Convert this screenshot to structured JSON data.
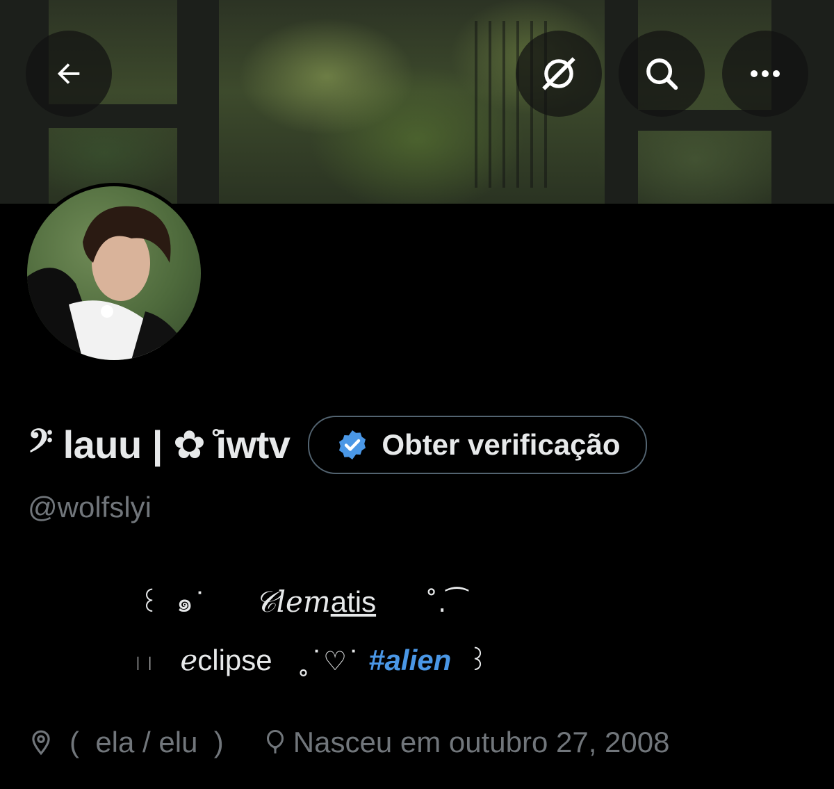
{
  "header": {
    "buttons": [
      {
        "name": "back-button",
        "icon": "arrow-left-icon"
      },
      {
        "name": "grok-button",
        "icon": "grok-icon"
      },
      {
        "name": "search-button",
        "icon": "search-icon"
      },
      {
        "name": "more-button",
        "icon": "more-horizontal-icon"
      }
    ]
  },
  "profile": {
    "display_name": "𝄢 lauu | ✿ ̊iwtv",
    "handle": "@wolfslyi",
    "verify_label": "Obter verificação",
    "verified_color": "#4a97e6"
  },
  "bio": {
    "line1_prefix": "꒰  ๑˙",
    "line1_word_start": "𝒞lem",
    "line1_word_end": "atis",
    "line1_suffix": "˚.⁀",
    "line2_prefix": "꒐꒐",
    "line2_word": "ℯclipse",
    "line2_deco": " ˳˙♡˙ ",
    "hashtag": "#alien",
    "line2_suffix": "꒱"
  },
  "meta": {
    "pronouns": "(  ela / elu  )",
    "birth": "Nasceu em outubro 27, 2008"
  },
  "colors": {
    "background": "#000000",
    "text": "#e7e9ea",
    "muted": "#71767b",
    "accent": "#4a97e6"
  }
}
